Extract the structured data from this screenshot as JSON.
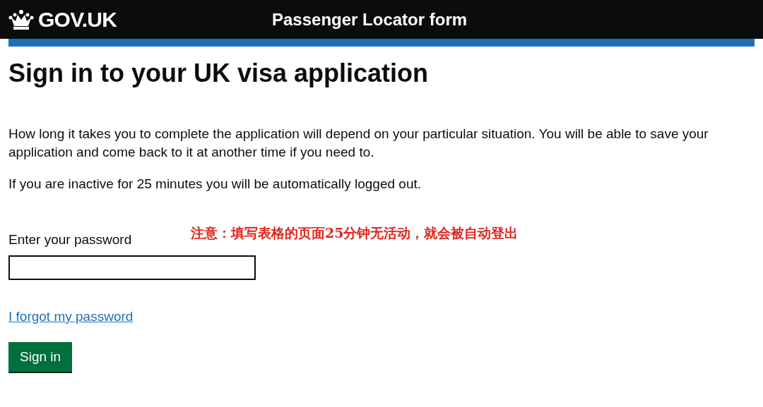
{
  "header": {
    "logo": "GOV.UK",
    "service_name": "Passenger Locator form"
  },
  "heading": "Sign in to your UK visa application",
  "paragraphs": [
    "How long it takes you to complete the application will depend on your particular situation. You will be able to save your application and come back to it at another time if you need to.",
    "If you are inactive for 25 minutes you will be automatically logged out."
  ],
  "annotation": "注意：填写表格的页面25分钟无活动，就会被自动登出",
  "password_field": {
    "label": "Enter your password"
  },
  "forgot_link": "I forgot my password",
  "sign_in_button": "Sign in"
}
